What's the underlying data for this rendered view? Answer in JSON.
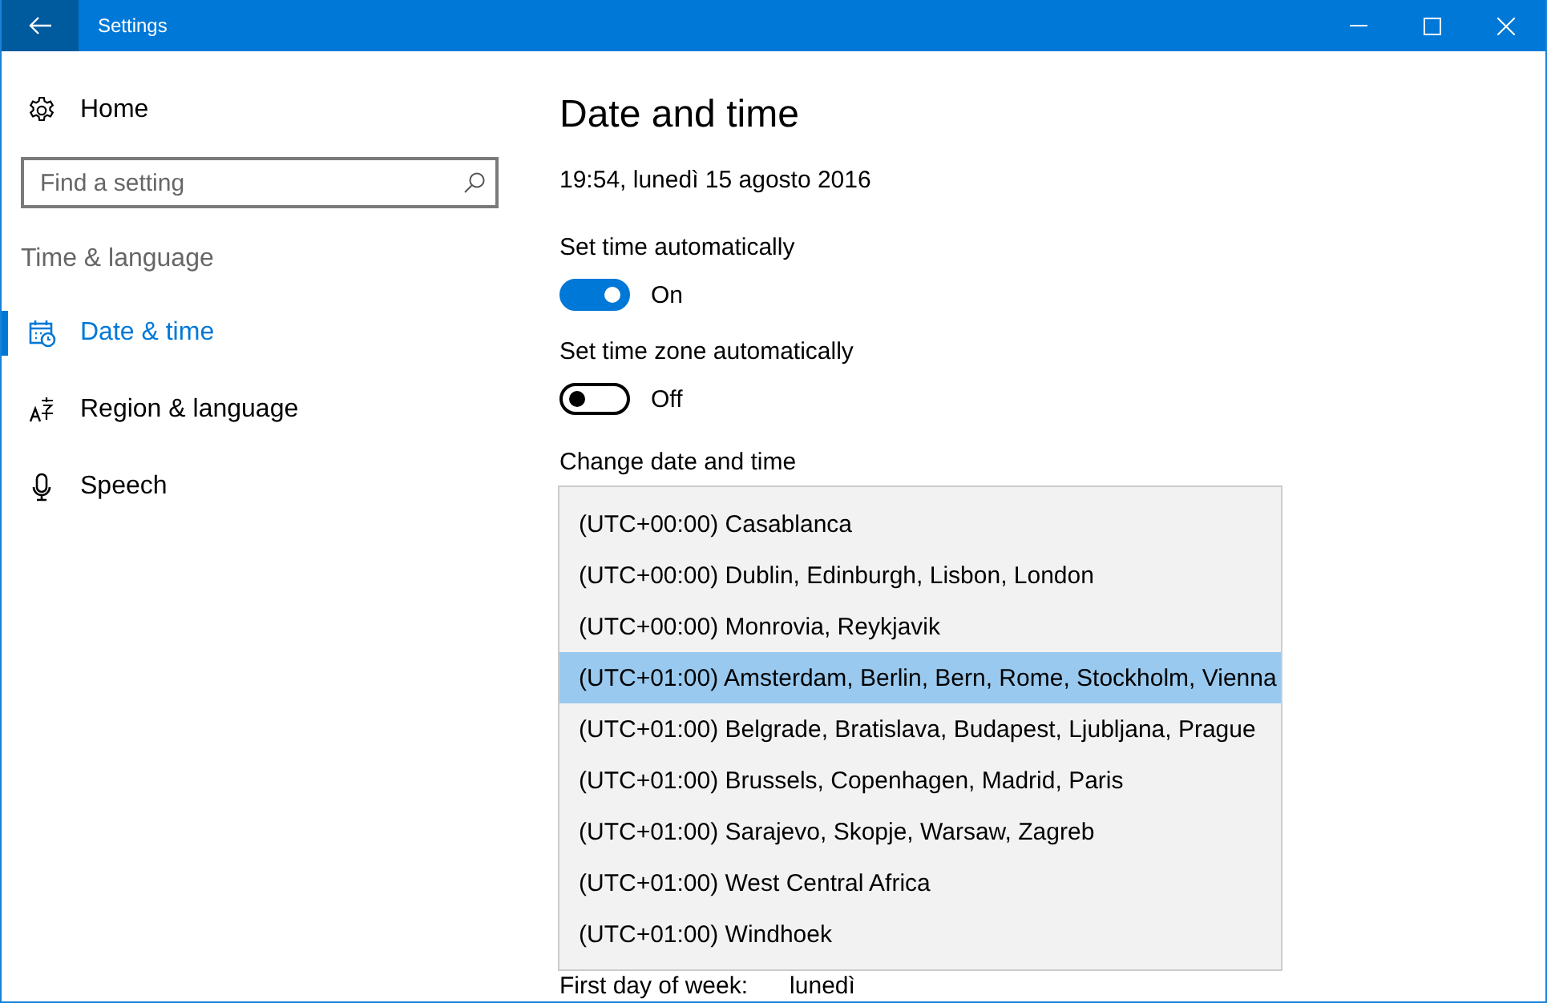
{
  "window": {
    "title": "Settings"
  },
  "sidebar": {
    "home": "Home",
    "search": {
      "placeholder": "Find a setting"
    },
    "section": "Time & language",
    "items": [
      {
        "label": "Date & time",
        "selected": true
      },
      {
        "label": "Region & language",
        "selected": false
      },
      {
        "label": "Speech",
        "selected": false
      }
    ]
  },
  "page": {
    "title": "Date and time",
    "current_datetime": "19:54, lunedì 15 agosto 2016",
    "toggles": [
      {
        "label": "Set time automatically",
        "on": true,
        "state_text": "On"
      },
      {
        "label": "Set time zone automatically",
        "on": false,
        "state_text": "Off"
      }
    ],
    "change_heading": "Change date and time",
    "time_zone_list": [
      {
        "label": "(UTC+00:00) Casablanca",
        "selected": false
      },
      {
        "label": "(UTC+00:00) Dublin, Edinburgh, Lisbon, London",
        "selected": false
      },
      {
        "label": "(UTC+00:00) Monrovia, Reykjavik",
        "selected": false
      },
      {
        "label": "(UTC+01:00) Amsterdam, Berlin, Bern, Rome, Stockholm, Vienna",
        "selected": true
      },
      {
        "label": "(UTC+01:00) Belgrade, Bratislava, Budapest, Ljubljana, Prague",
        "selected": false
      },
      {
        "label": "(UTC+01:00) Brussels, Copenhagen, Madrid, Paris",
        "selected": false
      },
      {
        "label": "(UTC+01:00) Sarajevo, Skopje, Warsaw, Zagreb",
        "selected": false
      },
      {
        "label": "(UTC+01:00) West Central Africa",
        "selected": false
      },
      {
        "label": "(UTC+01:00) Windhoek",
        "selected": false
      }
    ],
    "first_day_of_week": {
      "label": "First day of week:",
      "value": "lunedì"
    }
  }
}
